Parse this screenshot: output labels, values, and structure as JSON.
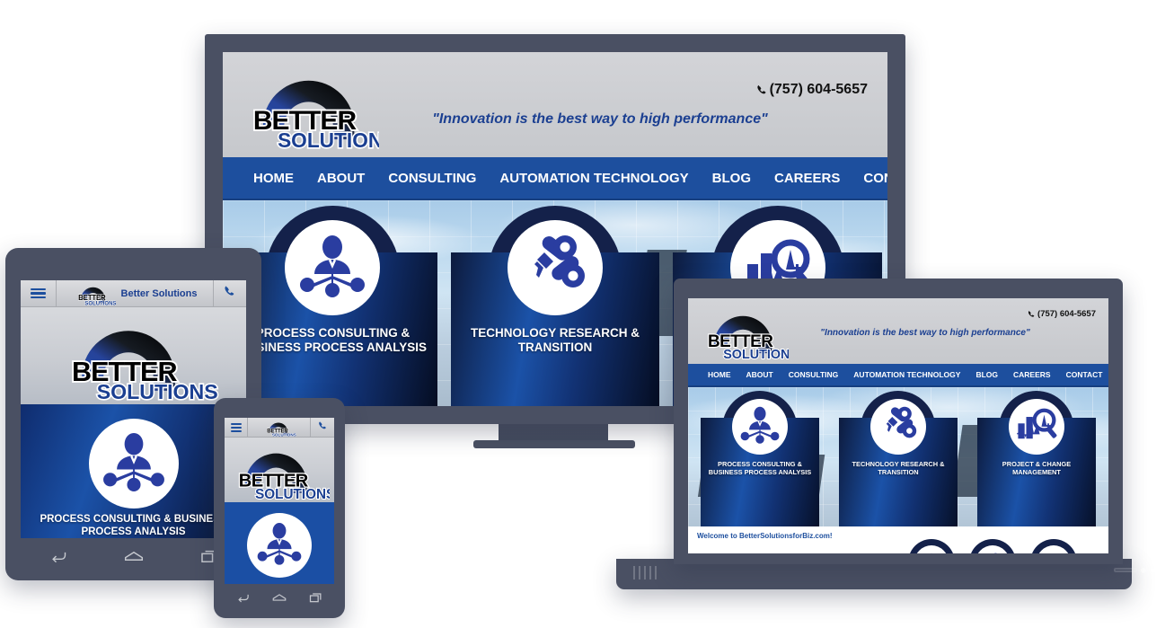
{
  "site": {
    "brand_name": "Better Solutions",
    "brand_word_top": "BETTER",
    "brand_word_bottom": "SOLUTIONS",
    "tagline": "\"Innovation is the best way to high performance\"",
    "phone": "(757) 604-5657",
    "phone_icon": "phone-handset-icon",
    "nav": [
      {
        "label": "HOME"
      },
      {
        "label": "ABOUT"
      },
      {
        "label": "CONSULTING"
      },
      {
        "label": "AUTOMATION TECHNOLOGY"
      },
      {
        "label": "BLOG"
      },
      {
        "label": "CAREERS"
      },
      {
        "label": "CONTACT"
      }
    ],
    "panels": [
      {
        "title": "PROCESS CONSULTING &\nBUSINESS PROCESS ANALYSIS",
        "icon": "consultant-network-icon"
      },
      {
        "title": "TECHNOLOGY RESEARCH &\nTRANSITION",
        "icon": "robot-arm-icon"
      },
      {
        "title": "PROJECT & CHANGE\nMANAGEMENT",
        "icon": "bar-chart-magnifier-icon"
      }
    ],
    "welcome_text": "Welcome to BetterSolutionsforBiz.com!"
  },
  "mobile": {
    "menu_icon": "hamburger-menu-icon",
    "call_icon": "phone-handset-icon",
    "brand_label": "Better Solutions",
    "card_title": "PROCESS CONSULTING & BUSINESS PROCESS ANALYSIS",
    "nav_back_icon": "android-back-icon",
    "nav_home_icon": "android-home-icon",
    "nav_recents_icon": "android-recents-icon"
  },
  "phone_device": {
    "menu_icon": "hamburger-menu-icon",
    "call_icon": "phone-handset-icon",
    "nav_back_icon": "android-back-icon",
    "nav_home_icon": "android-home-icon",
    "nav_recents_icon": "android-recents-icon"
  },
  "colors": {
    "bezel": "#4a5063",
    "nav_blue": "#1d4f9e",
    "header_grey": "#c8cacf",
    "brand_blue": "#1b3f91",
    "panel_navy": "#14214a",
    "icon_blue": "#2a3da0",
    "page_background": "#ffffff"
  }
}
